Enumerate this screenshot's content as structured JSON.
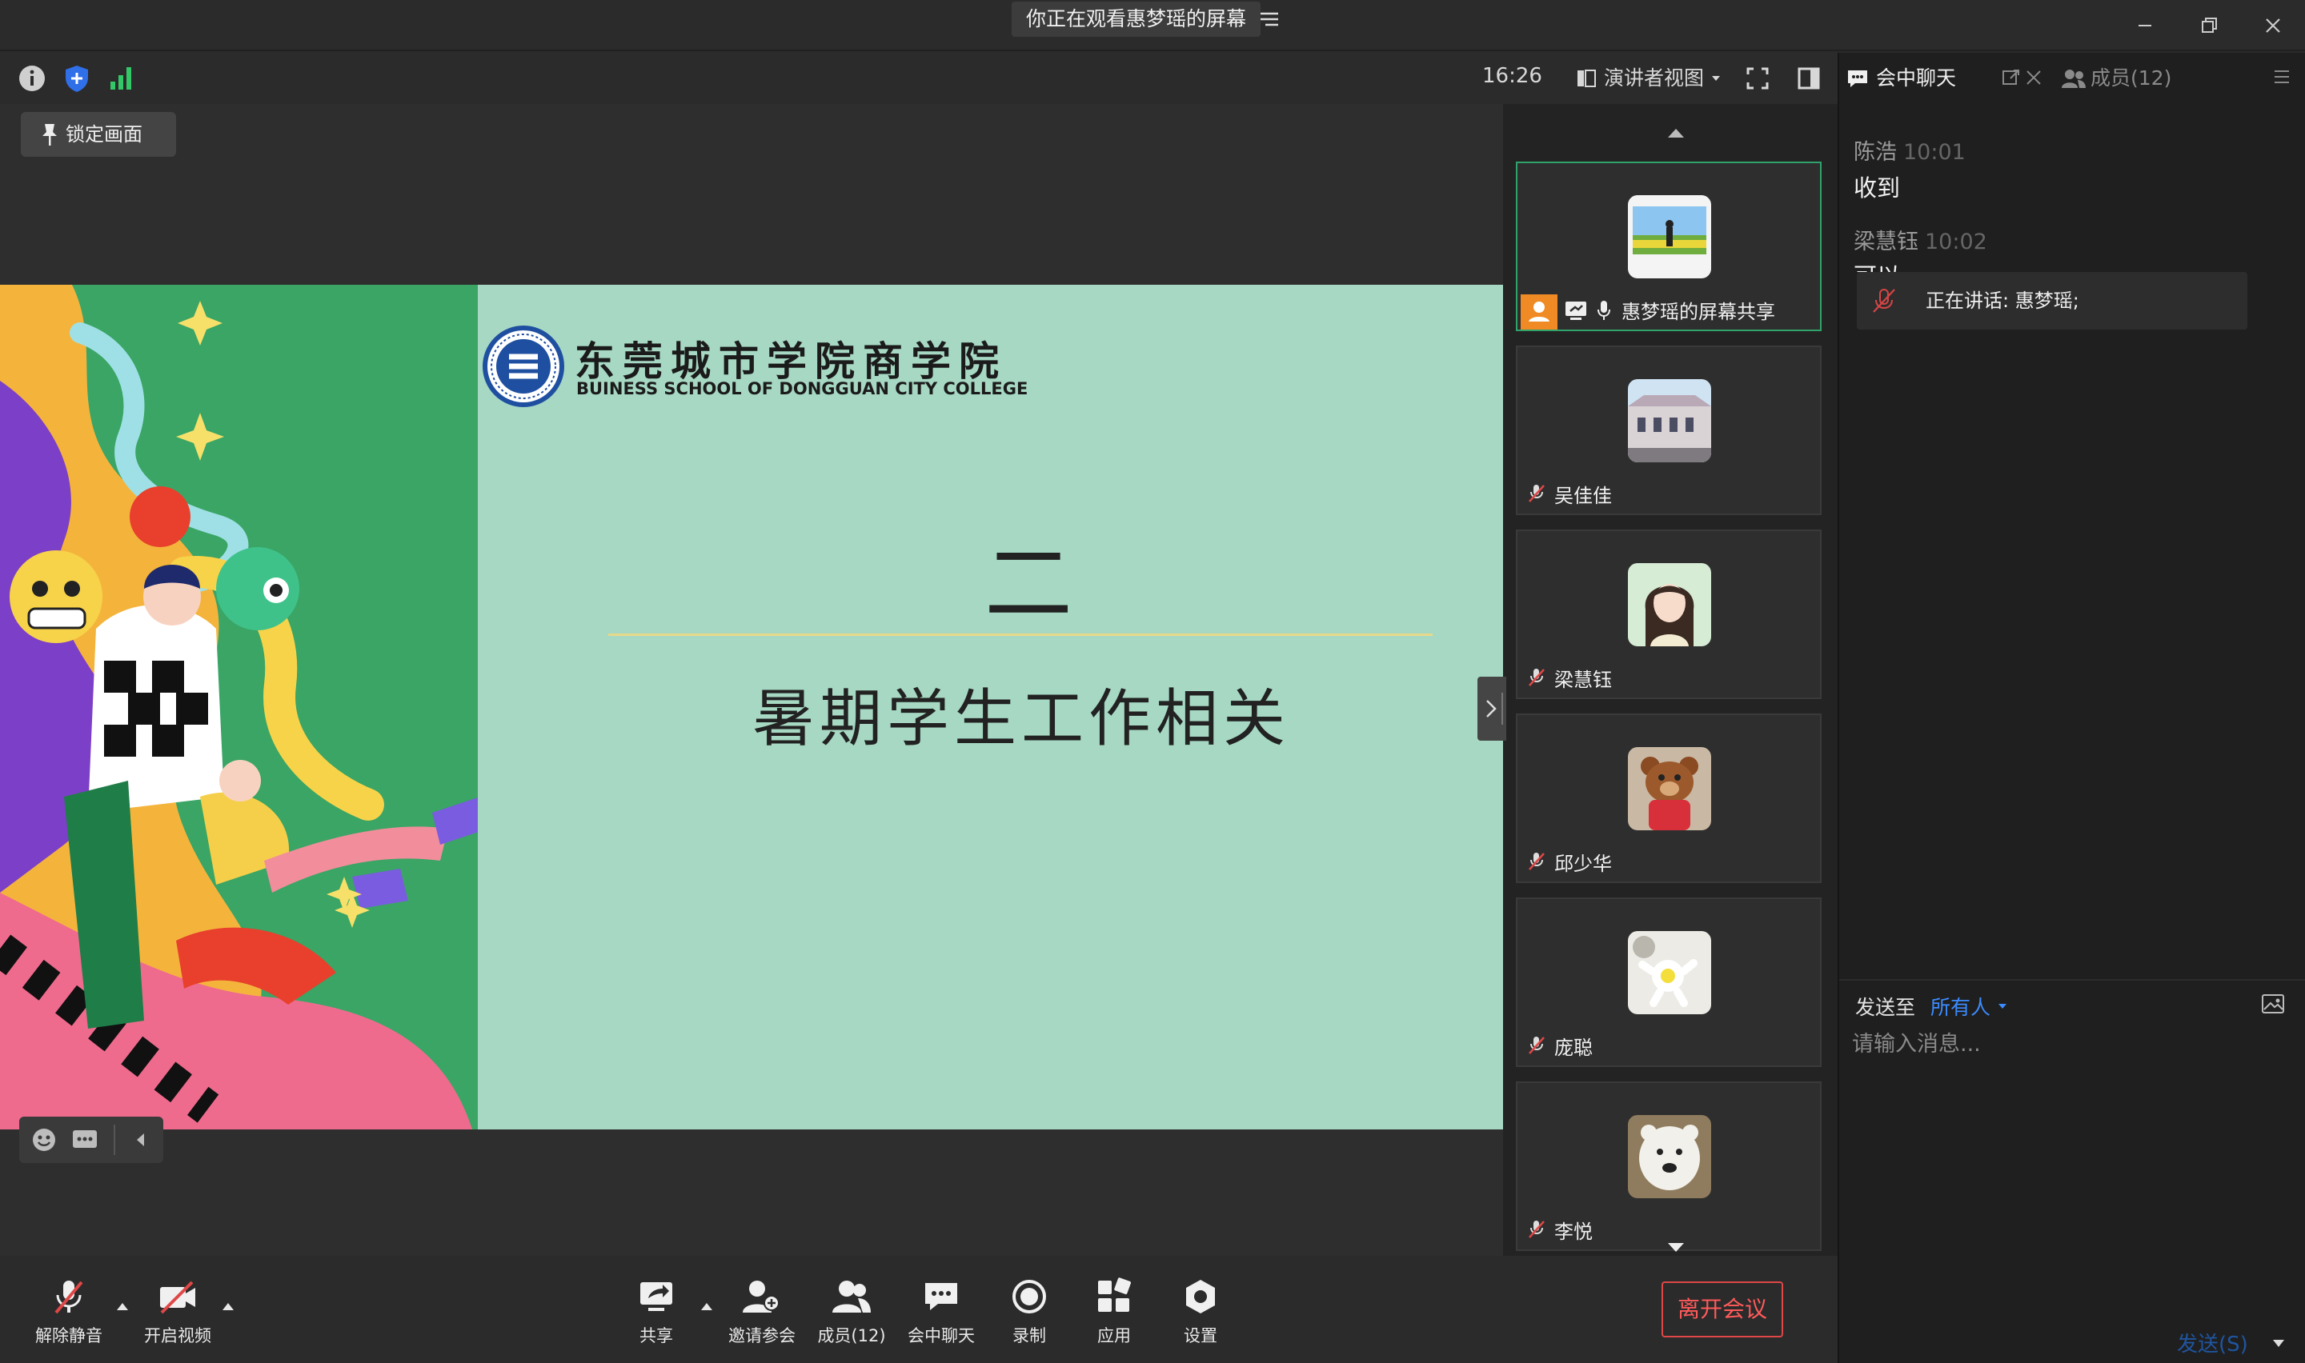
{
  "titlebar": {
    "banner": "你正在观看惠梦瑶的屏幕"
  },
  "topbar": {
    "time": "16:26",
    "view_mode": "演讲者视图"
  },
  "stage": {
    "lock_label": "锁定画面",
    "slide": {
      "school_cn": "东莞城市学院商学院",
      "school_en": "BUINESS SCHOOL OF DONGGUAN CITY COLLEGE",
      "number": "二",
      "title": "暑期学生工作相关"
    }
  },
  "participants": [
    {
      "name": "惠梦瑶的屏幕共享",
      "active": true
    },
    {
      "name": "吴佳佳"
    },
    {
      "name": "梁慧钰"
    },
    {
      "name": "邱少华"
    },
    {
      "name": "庞聪"
    },
    {
      "name": "李悦"
    }
  ],
  "chat": {
    "tab_chat": "会中聊天",
    "tab_members": "成员(12)",
    "messages": [
      {
        "sender": "陈浩",
        "time": "10:01",
        "text": "收到"
      },
      {
        "sender": "梁慧钰",
        "time": "10:02",
        "text": "可以"
      }
    ],
    "speaking": "正在讲话: 惠梦瑶;",
    "send_to_label": "发送至",
    "send_to_target": "所有人",
    "input_placeholder": "请输入消息...",
    "send_button": "发送(S)"
  },
  "toolbar": {
    "unmute": "解除静音",
    "start_video": "开启视频",
    "share": "共享",
    "invite": "邀请参会",
    "members": "成员(12)",
    "chat": "会中聊天",
    "record": "录制",
    "apps": "应用",
    "settings": "设置",
    "leave": "离开会议"
  },
  "colors": {
    "accent": "#2fa36b",
    "leave": "#e04747",
    "link": "#3c8cff",
    "slide_bg": "#a6d8c3"
  }
}
